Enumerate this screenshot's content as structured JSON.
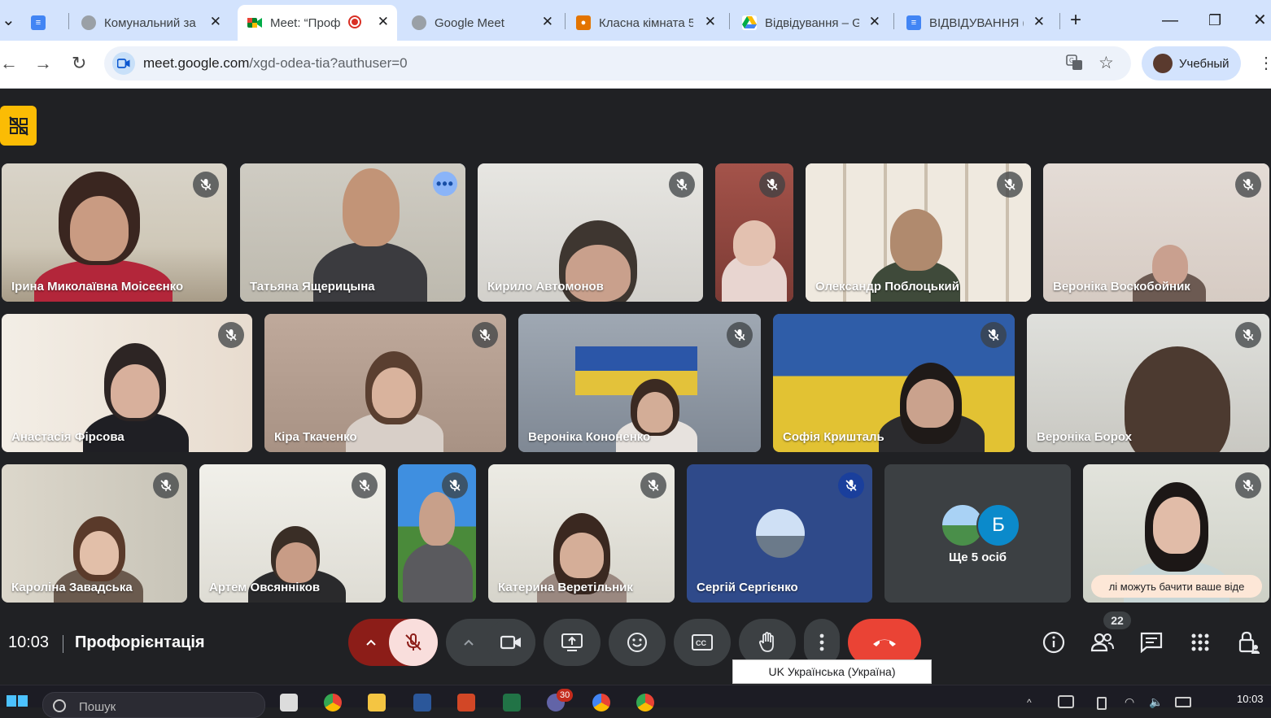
{
  "browser": {
    "tabs": [
      {
        "label": "",
        "icon": "docs-icon"
      },
      {
        "label": "Комунальний за",
        "icon": "globe-icon"
      },
      {
        "label": "Meet: “Проф",
        "icon": "meet-icon",
        "recording": true
      },
      {
        "label": "Google Meet",
        "icon": "globe-icon"
      },
      {
        "label": "Класна кімната 5",
        "icon": "classroom-icon"
      },
      {
        "label": "Відвідування – G",
        "icon": "drive-icon"
      },
      {
        "label": "ВІДВІДУВАННЯ (",
        "icon": "docs-icon"
      }
    ],
    "new_tab": "+",
    "url": {
      "host": "meet.google.com",
      "path": "/xgd-odea-tia?authuser=0"
    },
    "profile_name": "Учебный"
  },
  "meet": {
    "participants": [
      {
        "name": "Ірина Миколаївна Моісеєнко"
      },
      {
        "name": "Татьяна Ящерицына"
      },
      {
        "name": "Кирило Автомонов"
      },
      {
        "name": ""
      },
      {
        "name": "Олександр Поблоцький"
      },
      {
        "name": "Вероніка Воскобойник"
      },
      {
        "name": "Анастасія Фірсова"
      },
      {
        "name": "Кіра Ткаченко"
      },
      {
        "name": "Вероніка Кононенко"
      },
      {
        "name": "Софія Кришталь"
      },
      {
        "name": "Вероніка Борох"
      },
      {
        "name": "Кароліна Завадська"
      },
      {
        "name": "Артем Овсянніков"
      },
      {
        "name": ""
      },
      {
        "name": "Катерина Веретільник"
      },
      {
        "name": "Сергій Сергієнко"
      },
      {
        "name": ""
      }
    ],
    "more_people": {
      "label": "Ще 5 осіб",
      "avatar_letter": "Б"
    },
    "self_caption": "лі можуть бачити ваше віде",
    "time": "10:03",
    "title": "Профорієнтація",
    "participant_count": "22"
  },
  "taskbar": {
    "search_placeholder": "Пошук",
    "language_popup": "UK Українська (Україна)",
    "clock": "10:03",
    "teams_badge": "30"
  },
  "colors": {
    "end_call": "#ea4335",
    "mic_muted_bg": "#f9dedc",
    "accent_blue": "#8ab4f8"
  }
}
